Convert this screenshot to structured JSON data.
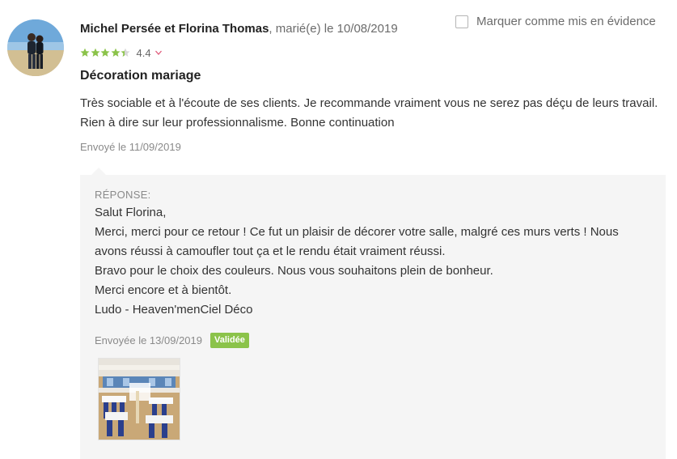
{
  "review": {
    "author": "Michel Persée et Florina Thomas",
    "meta": ", marié(e) le 10/08/2019",
    "rating": 4.4,
    "rating_label": "4.4",
    "title": "Décoration mariage",
    "text": "Très sociable et à l'écoute de ses clients. Je recommande vraiment vous ne serez pas déçu de leurs travail. Rien à dire sur leur professionnalisme. Bonne continuation",
    "sent": "Envoyé le 11/09/2019"
  },
  "feature": {
    "label": "Marquer comme mis en évidence",
    "checked": false
  },
  "reply": {
    "label": "RÉPONSE:",
    "lines": [
      "Salut Florina,",
      "Merci, merci pour ce retour ! Ce fut un plaisir de décorer votre salle, malgré ces murs verts ! Nous avons réussi à camoufler tout ça et le rendu était vraiment réussi.",
      "Bravo pour le choix des couleurs. Nous vous souhaitons plein de bonheur.",
      "Merci encore et à bientôt.",
      "Ludo - Heaven'menCiel Déco"
    ],
    "sent": "Envoyée le 13/09/2019",
    "status": "Validée"
  },
  "icons": {
    "star": "star-icon",
    "chevron": "chevron-down-icon",
    "checkbox": "checkbox-icon"
  },
  "colors": {
    "star": "#8bc34a",
    "star_empty": "#d6d6d6",
    "chevron": "#e05a7a",
    "badge": "#8bc34a",
    "reply_bg": "#f5f5f5"
  }
}
